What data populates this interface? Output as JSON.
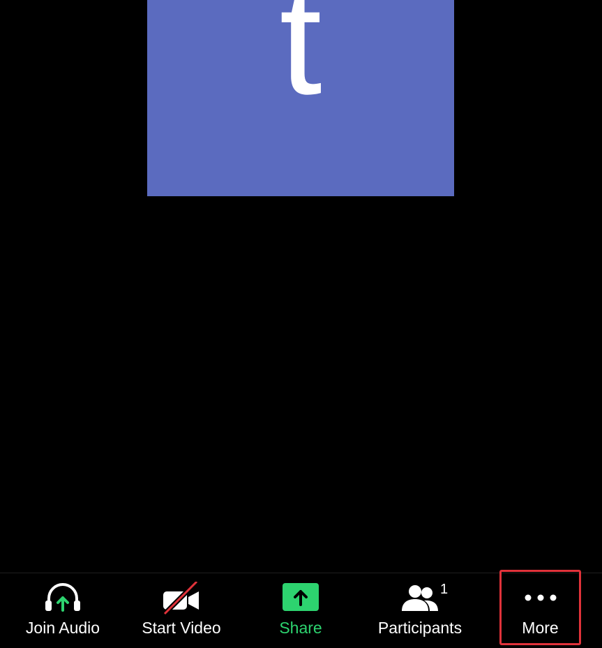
{
  "meeting": {
    "avatar_letter": "t",
    "avatar_color": "#5b6bbf"
  },
  "toolbar": {
    "join_audio_label": "Join Audio",
    "start_video_label": "Start Video",
    "share_label": "Share",
    "participants_label": "Participants",
    "participants_count": "1",
    "more_label": "More",
    "accent_green": "#2dd36f",
    "highlight_color": "#e0323a"
  },
  "icons": {
    "join_audio": "headphones-up-arrow-icon",
    "start_video": "video-camera-off-icon",
    "share": "share-up-arrow-icon",
    "participants": "people-icon",
    "more": "more-dots-icon"
  }
}
